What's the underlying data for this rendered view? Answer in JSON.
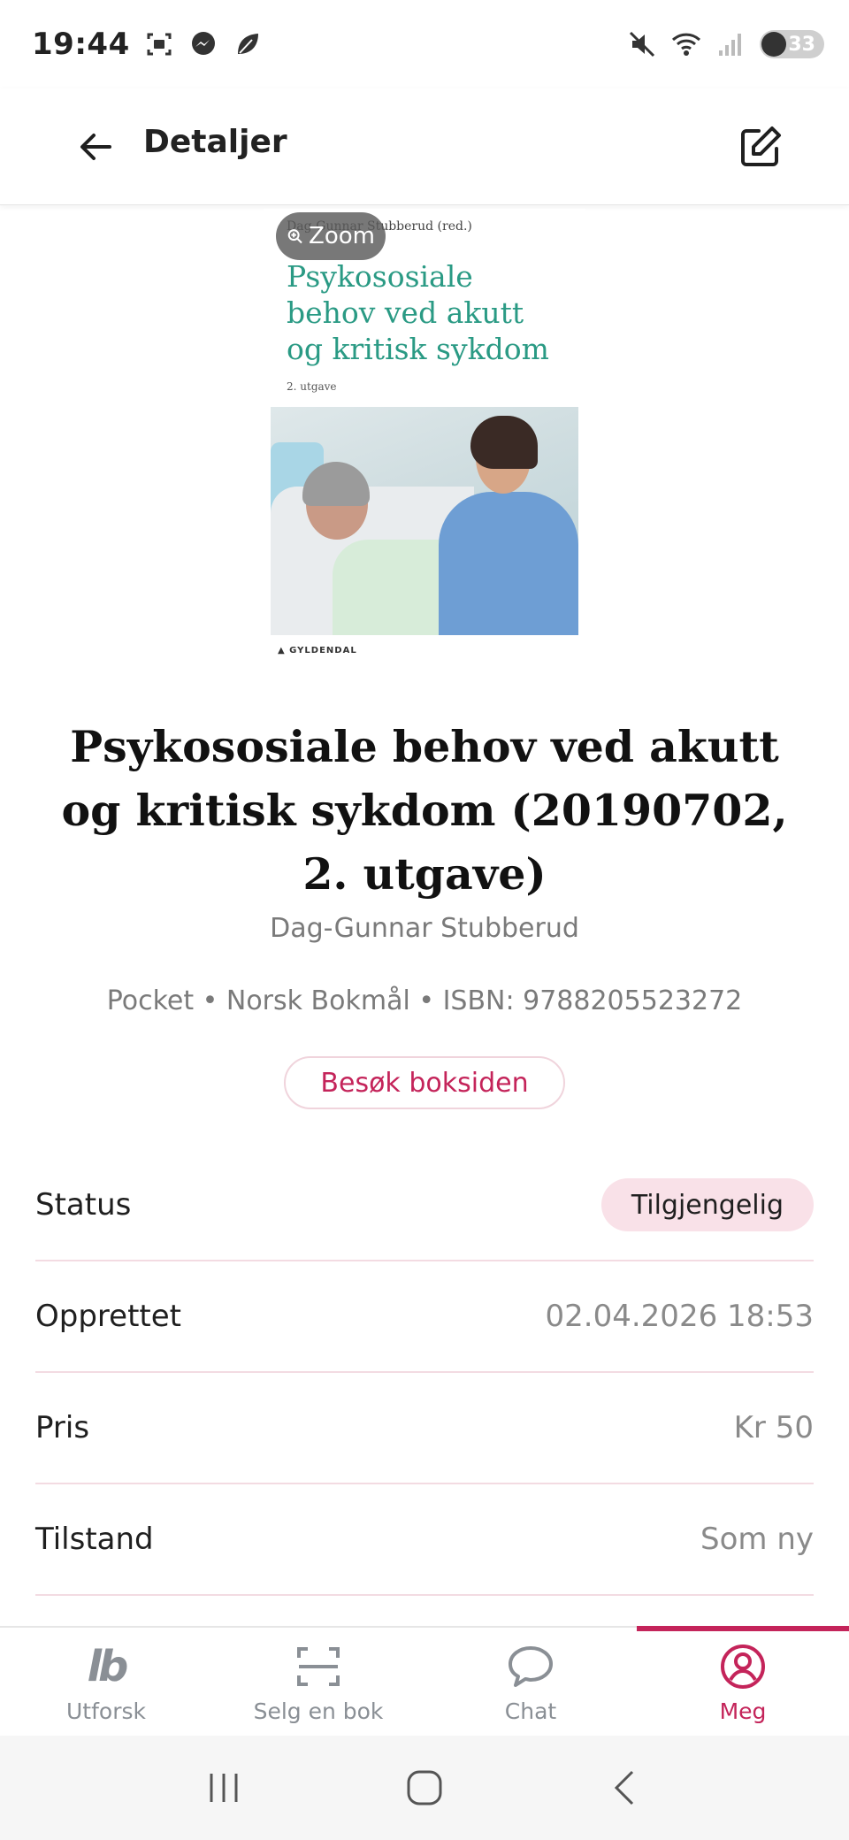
{
  "status_bar": {
    "time": "19:44",
    "battery": "33",
    "icons": [
      "screenshot-icon",
      "messenger-icon",
      "leaf-icon",
      "mute-icon",
      "wifi-icon",
      "signal-icon",
      "battery-icon"
    ]
  },
  "header": {
    "title": "Detaljer",
    "back_icon": "arrow-left-icon",
    "edit_icon": "edit-icon"
  },
  "cover": {
    "zoom_label": "Zoom",
    "author_line": "Dag-Gunnar Stubberud (red.)",
    "title_lines": [
      "Psykososiale",
      "behov ved akutt",
      "og kritisk sykdom"
    ],
    "edition": "2. utgave",
    "publisher": "GYLDENDAL"
  },
  "book": {
    "title": "Psykososiale behov ved akutt og kritisk sykdom (20190702, 2. utgave)",
    "author": "Dag-Gunnar Stubberud",
    "meta": "Pocket • Norsk Bokmål • ISBN: 9788205523272",
    "visit_label": "Besøk boksiden"
  },
  "details": [
    {
      "label": "Status",
      "value": "Tilgjengelig",
      "badge": true
    },
    {
      "label": "Opprettet",
      "value": "02.04.2026 18:53"
    },
    {
      "label": "Pris",
      "value": "Kr 50"
    },
    {
      "label": "Tilstand",
      "value": "Som ny"
    }
  ],
  "nav": {
    "items": [
      {
        "label": "Utforsk",
        "icon": "lb-logo-icon"
      },
      {
        "label": "Selg en bok",
        "icon": "scan-icon"
      },
      {
        "label": "Chat",
        "icon": "chat-icon"
      },
      {
        "label": "Meg",
        "icon": "profile-icon",
        "active": true
      }
    ],
    "logo_text": "lb"
  },
  "colors": {
    "accent": "#c4245a",
    "badge_bg": "#f9e1e8",
    "divider": "#f3dbe2",
    "muted_text": "#7a7a7a",
    "cover_title": "#2a9a84"
  }
}
